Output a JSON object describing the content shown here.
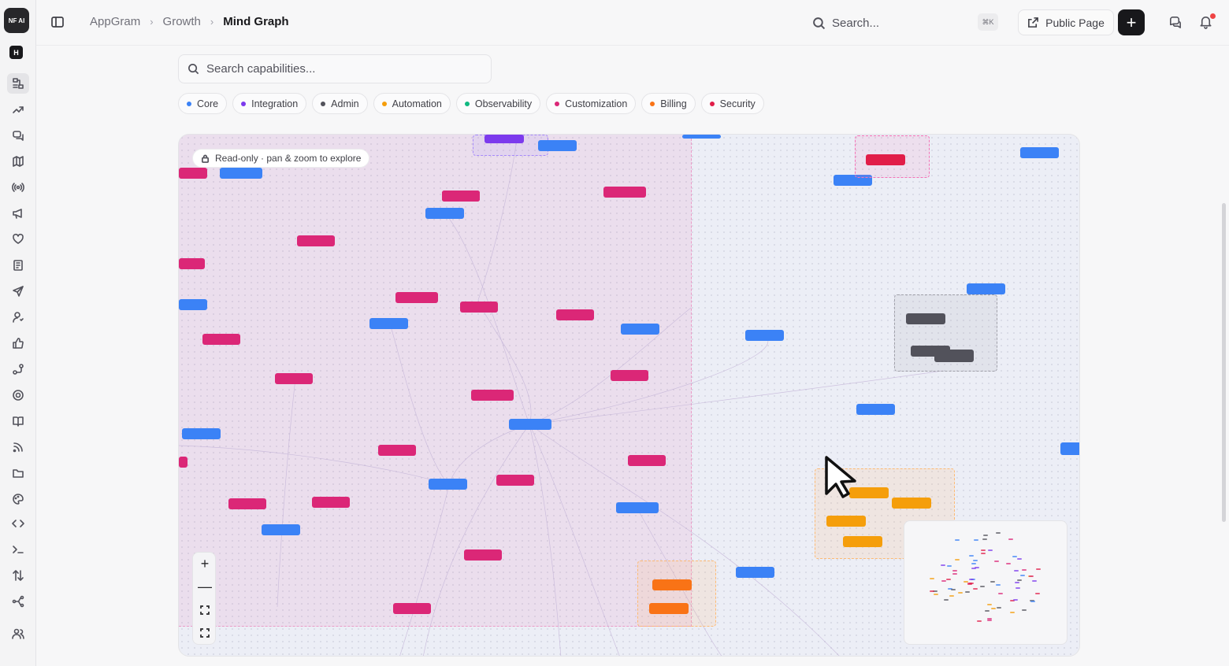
{
  "app": {
    "logo_text": "NF AI",
    "workspace_initial": "H"
  },
  "breadcrumb": {
    "items": [
      "AppGram",
      "Growth"
    ],
    "current": "Mind Graph"
  },
  "topbar": {
    "search_placeholder": "Search...",
    "shortcut": "⌘K",
    "public_page_label": "Public Page",
    "add_label": "+"
  },
  "capabilities": {
    "search_placeholder": "Search capabilities...",
    "categories": [
      {
        "label": "Core",
        "color": "#3b82f6"
      },
      {
        "label": "Integration",
        "color": "#7c3aed"
      },
      {
        "label": "Admin",
        "color": "#52525b"
      },
      {
        "label": "Automation",
        "color": "#f59e0b"
      },
      {
        "label": "Observability",
        "color": "#10b981"
      },
      {
        "label": "Customization",
        "color": "#db2777"
      },
      {
        "label": "Billing",
        "color": "#f97316"
      },
      {
        "label": "Security",
        "color": "#e11d48"
      }
    ]
  },
  "graph": {
    "readonly_label": "Read-only · pan & zoom to explore",
    "zoom_in": "+",
    "zoom_out": "—"
  }
}
